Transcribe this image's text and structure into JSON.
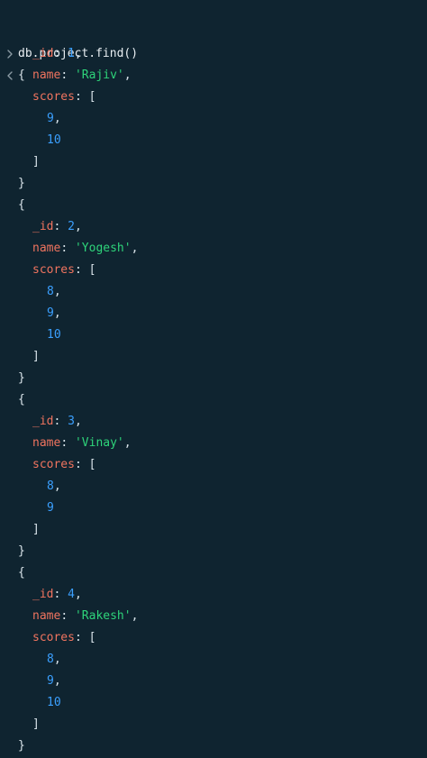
{
  "terminal": {
    "command": "db.project.find()",
    "open_brace": "{",
    "close_brace": "}",
    "open_bracket": "[",
    "close_bracket": "]",
    "comma": ",",
    "colon": ":",
    "space": " ",
    "id_key": "_id",
    "name_key": "name",
    "scores_key": "scores",
    "quote": "'"
  },
  "documents": [
    {
      "id": "1",
      "name": "Rajiv",
      "scores": [
        "9",
        "10"
      ]
    },
    {
      "id": "2",
      "name": "Yogesh",
      "scores": [
        "8",
        "9",
        "10"
      ]
    },
    {
      "id": "3",
      "name": "Vinay",
      "scores": [
        "8",
        "9"
      ]
    },
    {
      "id": "4",
      "name": "Rakesh",
      "scores": [
        "8",
        "9",
        "10"
      ]
    }
  ],
  "icons": {
    "prompt": "chevron-right-icon",
    "output": "chevron-left-icon"
  },
  "colors": {
    "background": "#0f2430",
    "default_text": "#d9e4ea",
    "key": "#f0745f",
    "number": "#3ba0ff",
    "string": "#2ed47a",
    "icon": "#8b9aa3"
  }
}
